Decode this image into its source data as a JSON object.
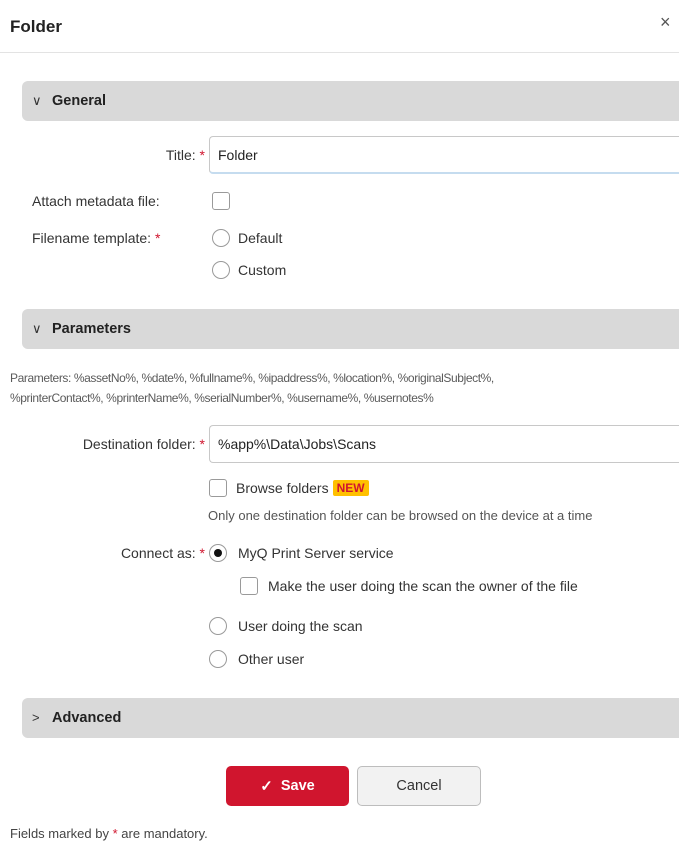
{
  "dialog": {
    "title": "Folder",
    "close_glyph": "×"
  },
  "sections": {
    "general": {
      "label": "General",
      "chevron": "∨"
    },
    "parameters": {
      "label": "Parameters",
      "chevron": "∨"
    },
    "advanced": {
      "label": "Advanced",
      "chevron": ">"
    }
  },
  "general": {
    "title_label": "Title:",
    "title_value": "Folder",
    "attach_label": "Attach metadata file:",
    "attach_checked": false,
    "filename_label": "Filename template:",
    "filename_options": [
      {
        "label": "Default",
        "checked": false
      },
      {
        "label": "Custom",
        "checked": false
      }
    ]
  },
  "parameters": {
    "list_line1": "Parameters: %assetNo%, %date%, %fullname%, %ipaddress%, %location%, %originalSubject%,",
    "list_line2": "%printerContact%, %printerName%, %serialNumber%, %username%, %usernotes%",
    "destination_label": "Destination folder:",
    "destination_value": "%app%\\Data\\Jobs\\Scans",
    "browse_label": "Browse folders",
    "browse_badge": "NEW",
    "browse_hint": "Only one destination folder can be browsed on the device at a time",
    "connect_label": "Connect as:",
    "connect_options": [
      {
        "label": "MyQ Print Server service",
        "checked": true
      },
      {
        "label": "User doing the scan",
        "checked": false
      },
      {
        "label": "Other user",
        "checked": false
      }
    ],
    "owner_label": "Make the user doing the scan the owner of the file"
  },
  "required_marker": "*",
  "buttons": {
    "save_label": "Save",
    "save_icon": "✓",
    "cancel_label": "Cancel"
  },
  "footer": {
    "note_pre": "Fields marked by",
    "note_marker": "*",
    "note_post": "are mandatory."
  },
  "colors": {
    "accent": "#d0152e",
    "section_bg": "#d9d9d9",
    "badge_bg": "#ffc000"
  }
}
